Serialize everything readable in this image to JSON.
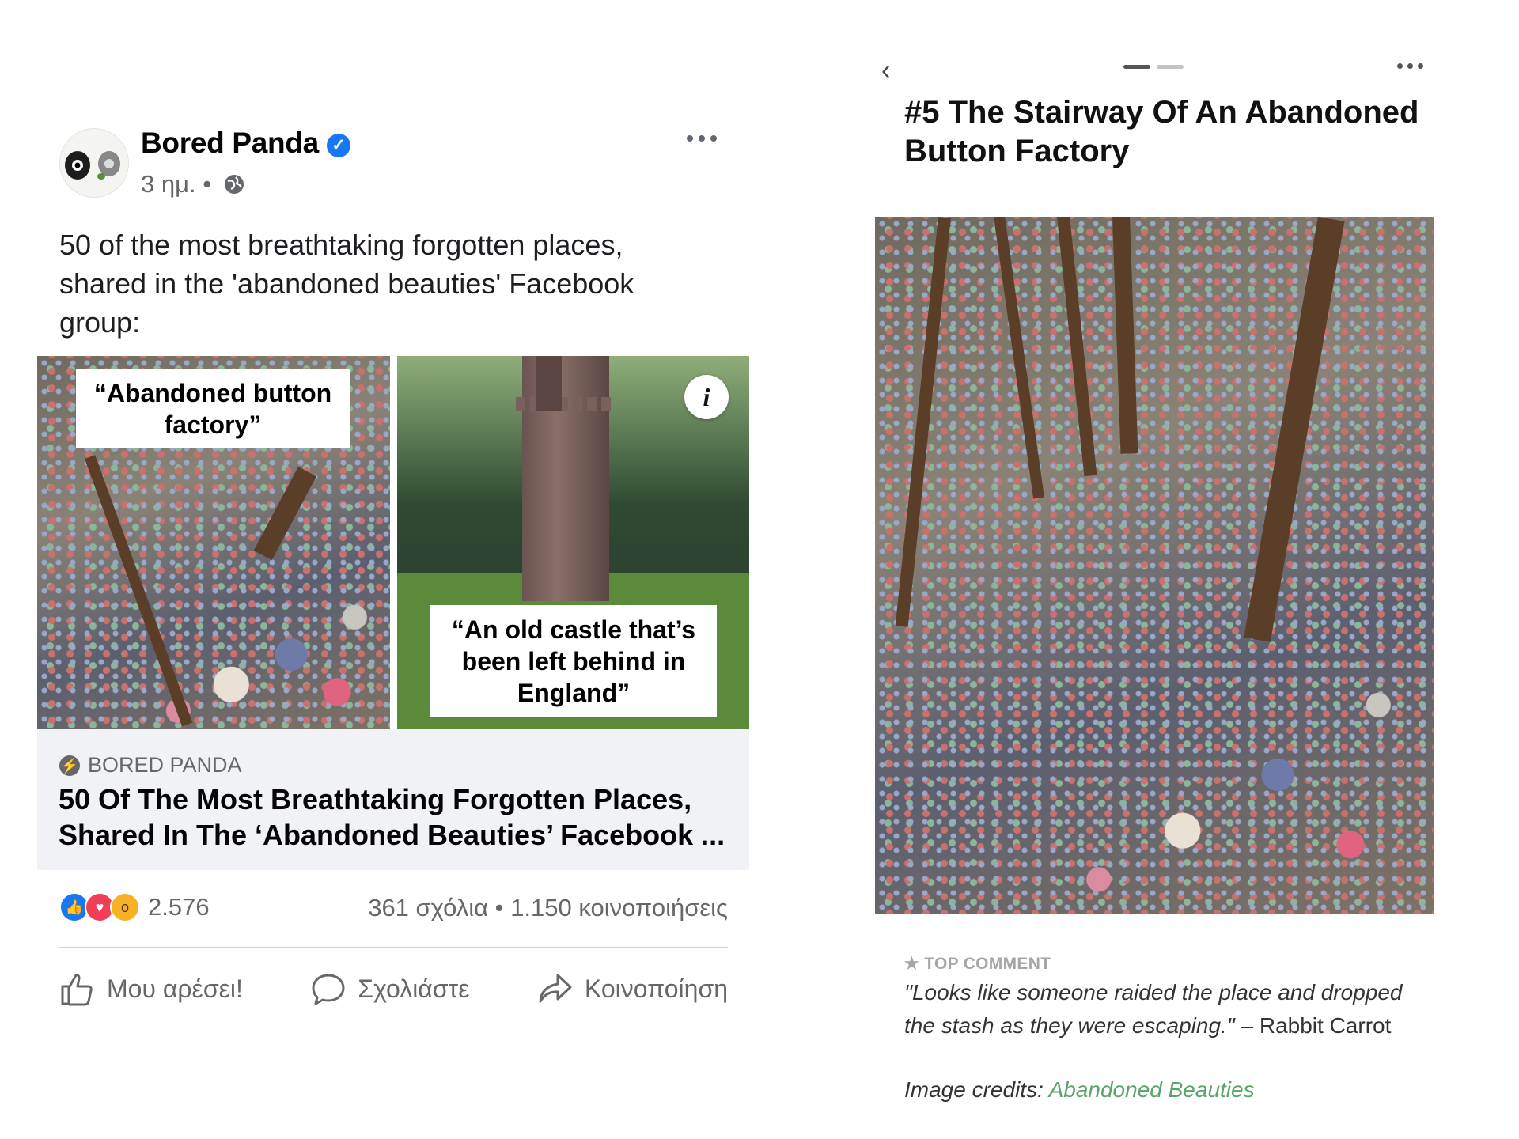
{
  "post": {
    "author": "Bored Panda",
    "time": "3 ημ.",
    "separator": "•",
    "caption": "50 of the most breathtaking forgotten places, shared in the 'abandoned beauties' Facebook group:",
    "images": [
      {
        "overlay": "“Abandoned button factory”"
      },
      {
        "overlay": "“An old castle that’s been left behind in England”",
        "info_glyph": "i"
      }
    ],
    "link": {
      "source": "BORED PANDA",
      "title": "50 Of The Most Breathtaking Forgotten Places, Shared In The ‘Abandoned Beauties’ Facebook ..."
    },
    "reactions": {
      "count": "2.576",
      "types": [
        "like",
        "love",
        "wow"
      ]
    },
    "stats": "361 σχόλια • 1.150 κοινοποιήσεις",
    "actions": {
      "like": "Μου αρέσει!",
      "comment": "Σχολιάστε",
      "share": "Κοινοποίηση"
    },
    "colors": {
      "verified": "#1877f2",
      "like": "#1877f2",
      "love": "#f33e58",
      "wow": "#f7b125"
    }
  },
  "article": {
    "title": "#5 The Stairway Of An Abandoned Button Factory",
    "top_comment_label": "★ TOP COMMENT",
    "comment_quote": "\"Looks like someone raided the place and dropped the stash as they were escaping.\"",
    "comment_author": " – Rabbit Carrot",
    "credits_label": "Image credits: ",
    "credits_link": "Abandoned Beauties",
    "colors": {
      "link": "#5aa46a"
    }
  }
}
